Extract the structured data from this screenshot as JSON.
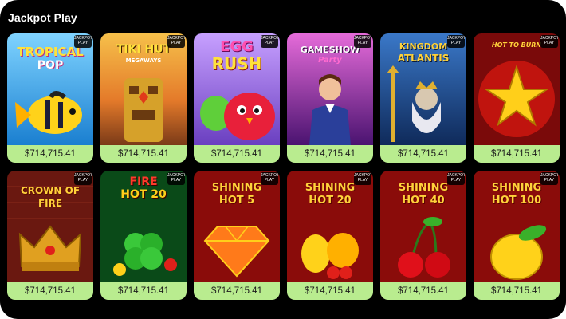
{
  "section": {
    "title": "Jackpot Play"
  },
  "badge_text": "JACKPOT PLAY",
  "tiles": [
    {
      "name": "Tropical Pop",
      "title": "TROPICAL",
      "subtitle": "POP",
      "price": "$714,715.41",
      "accent": "#2ea8ee"
    },
    {
      "name": "Tiki Hut Megaways",
      "title": "TIKI HUT",
      "subtitle": "MEGAWAYS",
      "price": "$714,715.41",
      "accent": "#f39a2c"
    },
    {
      "name": "Egg Rush",
      "title": "EGG",
      "subtitle": "RUSH",
      "price": "$714,715.41",
      "accent": "#8e63d6"
    },
    {
      "name": "Gameshow Party",
      "title": "GAMESHOW",
      "subtitle": "Party",
      "price": "$714,715.41",
      "accent": "#c43fc2"
    },
    {
      "name": "Kingdom of Atlantis",
      "title": "KINGDOM",
      "subtitle": "ATLANTIS",
      "price": "$714,715.41",
      "accent": "#2a5aa6"
    },
    {
      "name": "Hot to Burn",
      "title": "HOT TO BURN",
      "subtitle": "",
      "price": "$714,715.41",
      "accent": "#a80a0a"
    },
    {
      "name": "Crown of Fire",
      "title": "CROWN OF",
      "subtitle": "FIRE",
      "price": "$714,715.41",
      "accent": "#8a1a10"
    },
    {
      "name": "Fire Hot 20",
      "title": "FIRE",
      "subtitle": "HOT 20",
      "price": "$714,715.41",
      "accent": "#0f7a28"
    },
    {
      "name": "Shining Hot 5",
      "title": "SHINING",
      "subtitle": "HOT 5",
      "price": "$714,715.41",
      "accent": "#a5120e"
    },
    {
      "name": "Shining Hot 20",
      "title": "SHINING",
      "subtitle": "HOT 20",
      "price": "$714,715.41",
      "accent": "#a5120e"
    },
    {
      "name": "Shining Hot 40",
      "title": "SHINING",
      "subtitle": "HOT 40",
      "price": "$714,715.41",
      "accent": "#a5120e"
    },
    {
      "name": "Shining Hot 100",
      "title": "SHINING",
      "subtitle": "HOT 100",
      "price": "$714,715.41",
      "accent": "#a5120e"
    }
  ]
}
